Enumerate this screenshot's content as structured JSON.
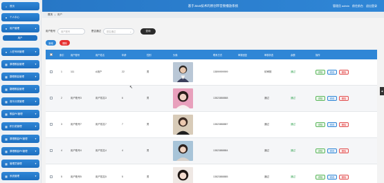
{
  "header": {
    "title": "基于Java技术的原创带音频播放系统",
    "user_role": "管理员 admin",
    "user_link": "前往前台",
    "logout": "退出登录"
  },
  "breadcrumb": {
    "home": "首页",
    "current": "用户"
  },
  "sidebar": {
    "items": [
      {
        "label": "首页",
        "icon": "home-icon"
      },
      {
        "label": "个人中心",
        "icon": "user-icon"
      },
      {
        "label": "用户管理",
        "icon": "user-icon",
        "expanded": true
      },
      {
        "label": "入驻号码管理",
        "icon": "user-icon"
      },
      {
        "label": "原唱歌曲管理",
        "icon": "grid-icon"
      },
      {
        "label": "翻唱歌曲管理",
        "icon": "grid-icon"
      },
      {
        "label": "翻唱歌曲管理",
        "icon": "grid-icon"
      },
      {
        "label": "音乐分类管理",
        "icon": "grid-icon"
      },
      {
        "label": "歌曲PK管理",
        "icon": "grid-icon"
      },
      {
        "label": "积分奖管理",
        "icon": "grid-icon"
      },
      {
        "label": "原唱歌曲PK管理",
        "icon": "grid-icon"
      },
      {
        "label": "原唱歌曲PK管理",
        "icon": "grid-icon"
      },
      {
        "label": "管理员管理",
        "icon": "grid-icon"
      },
      {
        "label": "系统管理",
        "icon": "grid-icon"
      }
    ],
    "sub_item": "用户"
  },
  "search": {
    "field1_label": "用户账号",
    "field1_placeholder": "用户账号",
    "field2_label": "是否通过",
    "field2_placeholder": "是否通过",
    "search_button": "查询"
  },
  "actions": {
    "add": "新增",
    "delete": "删除"
  },
  "table": {
    "columns": [
      "索引",
      "用户账号",
      "用户姓名",
      "年龄",
      "性别",
      "头像",
      "联系方式",
      "审核回复",
      "审核状态",
      "余额",
      "操作"
    ],
    "rows": [
      {
        "index": "1",
        "account": "111",
        "name": "A用户",
        "age": "22",
        "gender": "男",
        "phone": "13899999999",
        "reply": "",
        "audit": "待审核",
        "status": "通过"
      },
      {
        "index": "2",
        "account": "用户账号3",
        "name": "用户姓名3",
        "age": "6",
        "gender": "男",
        "phone": "13823888888",
        "reply": "",
        "audit": "通过",
        "status": "通过"
      },
      {
        "index": "3",
        "account": "用户账号7",
        "name": "用户姓名7",
        "age": "7",
        "gender": "男",
        "phone": "13823888887",
        "reply": "",
        "audit": "通过",
        "status": "通过"
      },
      {
        "index": "4",
        "account": "用户账号4",
        "name": "用户姓名4",
        "age": "4",
        "gender": "男",
        "phone": "13823888884",
        "reply": "",
        "audit": "通过",
        "status": "通过"
      },
      {
        "index": "5",
        "account": "用户账号5",
        "name": "用户姓名5",
        "age": "5",
        "gender": "男",
        "phone": "13823888885",
        "reply": "",
        "audit": "通过",
        "status": "通过"
      }
    ],
    "op_detail": "详情",
    "op_edit": "修改",
    "op_delete": "删除"
  },
  "colors": {
    "primary": "#2f86d6",
    "danger": "#e53030",
    "success": "#2da14d"
  }
}
